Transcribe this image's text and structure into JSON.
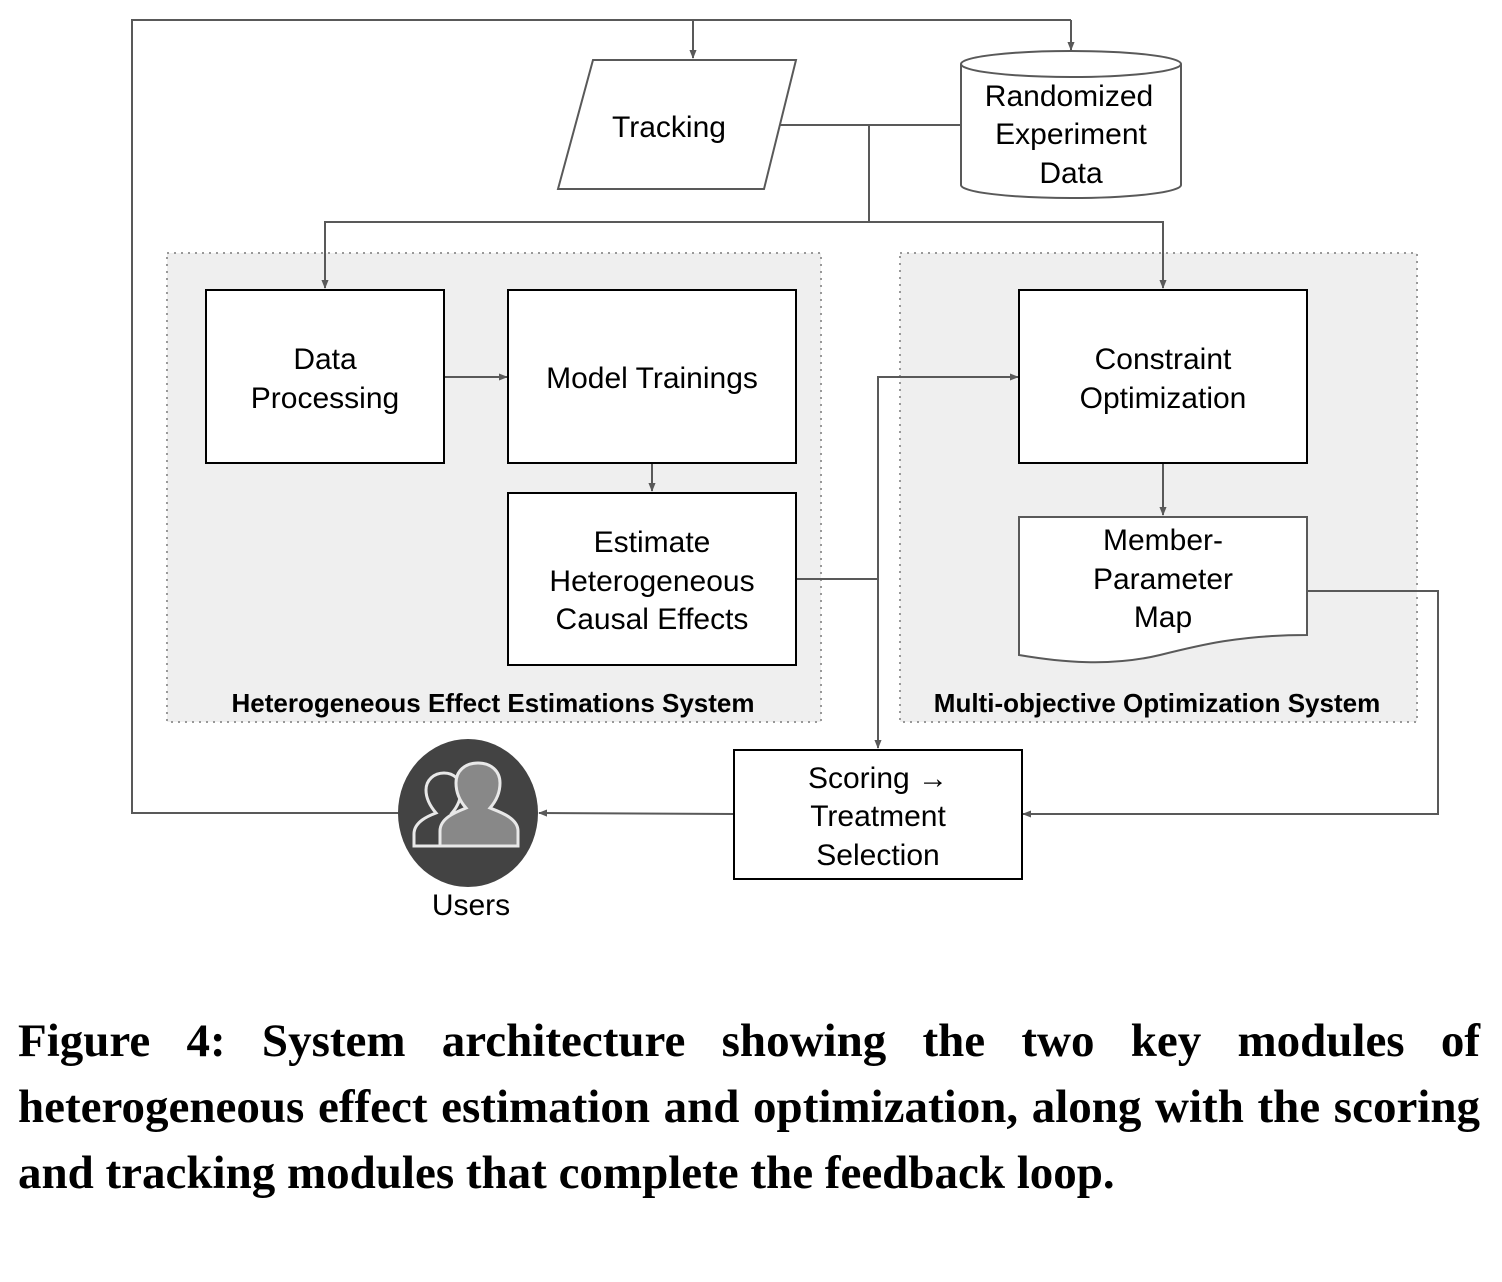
{
  "nodes": {
    "tracking": {
      "label": "Tracking"
    },
    "randomized": {
      "lines": [
        "Randomized",
        "Experiment",
        "Data"
      ]
    },
    "data_processing": {
      "lines": [
        "Data",
        "Processing"
      ]
    },
    "model_trainings": {
      "label": "Model Trainings"
    },
    "estimate": {
      "lines": [
        "Estimate",
        "Heterogeneous",
        "Causal Effects"
      ]
    },
    "constraint": {
      "lines": [
        "Constraint",
        "Optimization"
      ]
    },
    "member_map": {
      "lines": [
        "Member-",
        "Parameter",
        "Map"
      ]
    },
    "scoring": {
      "lines": [
        "Scoring →",
        "Treatment",
        "Selection"
      ]
    },
    "users": {
      "label": "Users"
    }
  },
  "groups": {
    "hee": {
      "label": "Heterogeneous Effect Estimations System"
    },
    "moo": {
      "label": "Multi-objective Optimization System"
    }
  },
  "colors": {
    "group_fill": "#efefef",
    "group_border": "#999999",
    "edge": "#595959",
    "node_border": "#000000",
    "users_circle": "#434343",
    "users_icon": "#888888"
  },
  "caption": "Figure 4: System architecture showing the two key modules of heterogeneous effect estimation and optimization, along with the scoring and tracking modules that complete the feedback loop."
}
